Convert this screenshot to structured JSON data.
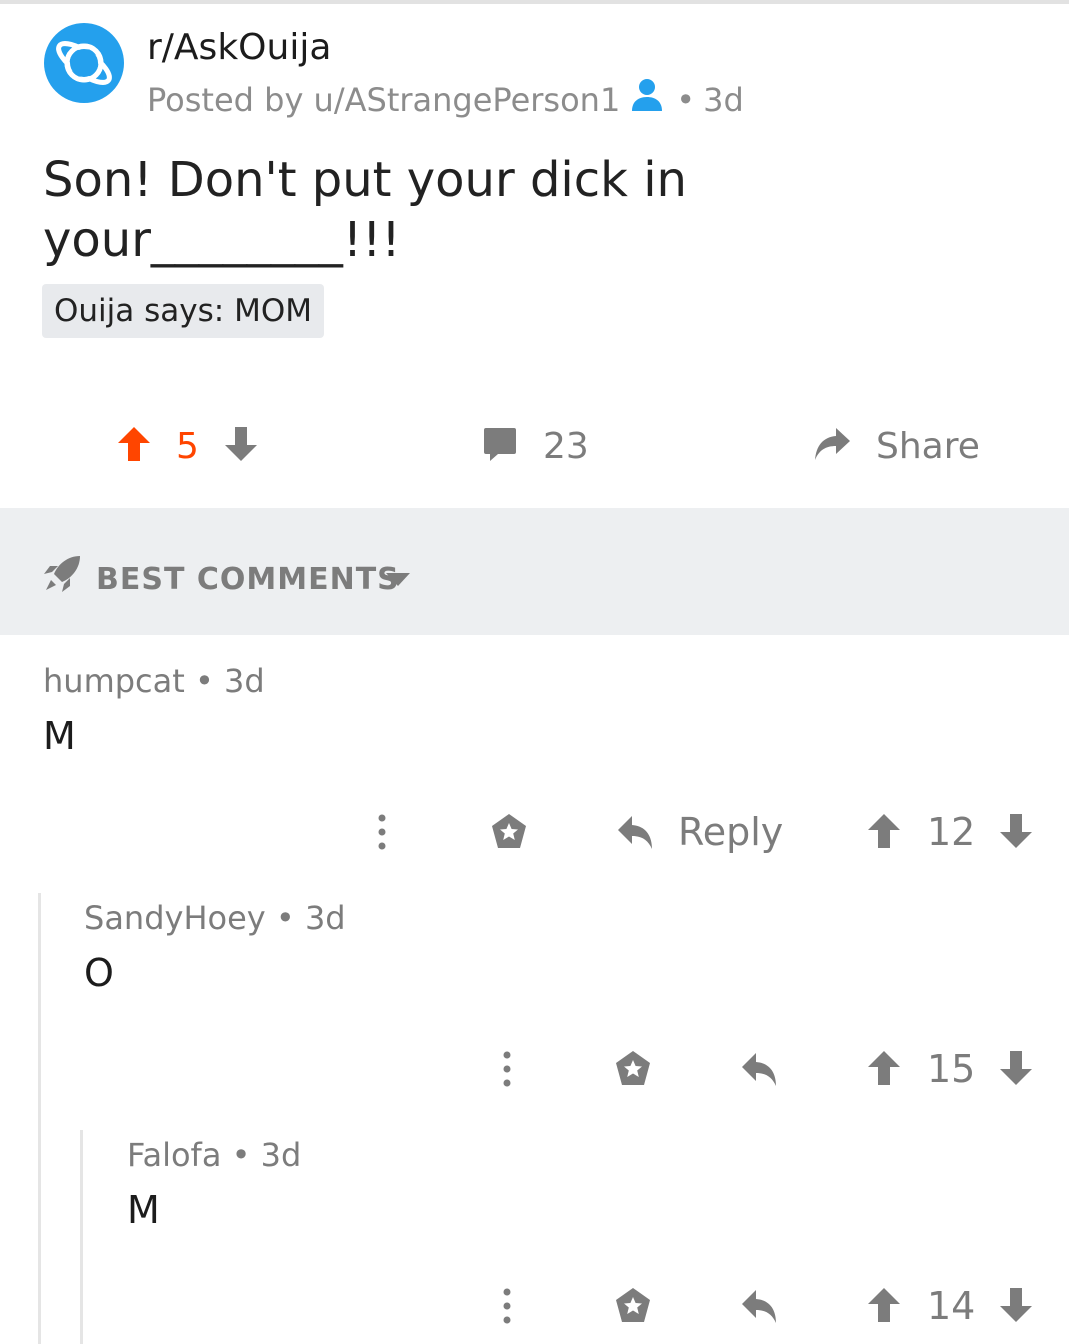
{
  "post": {
    "subreddit": "r/AskOuija",
    "posted_by": "Posted by u/AStrangePerson1",
    "age_sep": "•",
    "age": "3d",
    "title": "Son! Don't put your dick in your________!!!",
    "flair": "Ouija says: MOM",
    "score": "5",
    "comments": "23",
    "share_label": "Share"
  },
  "sort": {
    "label": "BEST COMMENTS"
  },
  "comments": [
    {
      "author": "humpcat",
      "sep": "•",
      "age": "3d",
      "body": "M",
      "score": "12",
      "reply_label": "Reply"
    },
    {
      "author": "SandyHoey",
      "sep": "•",
      "age": "3d",
      "body": "O",
      "score": "15"
    },
    {
      "author": "Falofa",
      "sep": "•",
      "age": "3d",
      "body": "M",
      "score": "14"
    }
  ],
  "colors": {
    "accent_upvote": "#ff4500",
    "subreddit_icon": "#24a0ed",
    "muted": "#7c7c7c"
  }
}
